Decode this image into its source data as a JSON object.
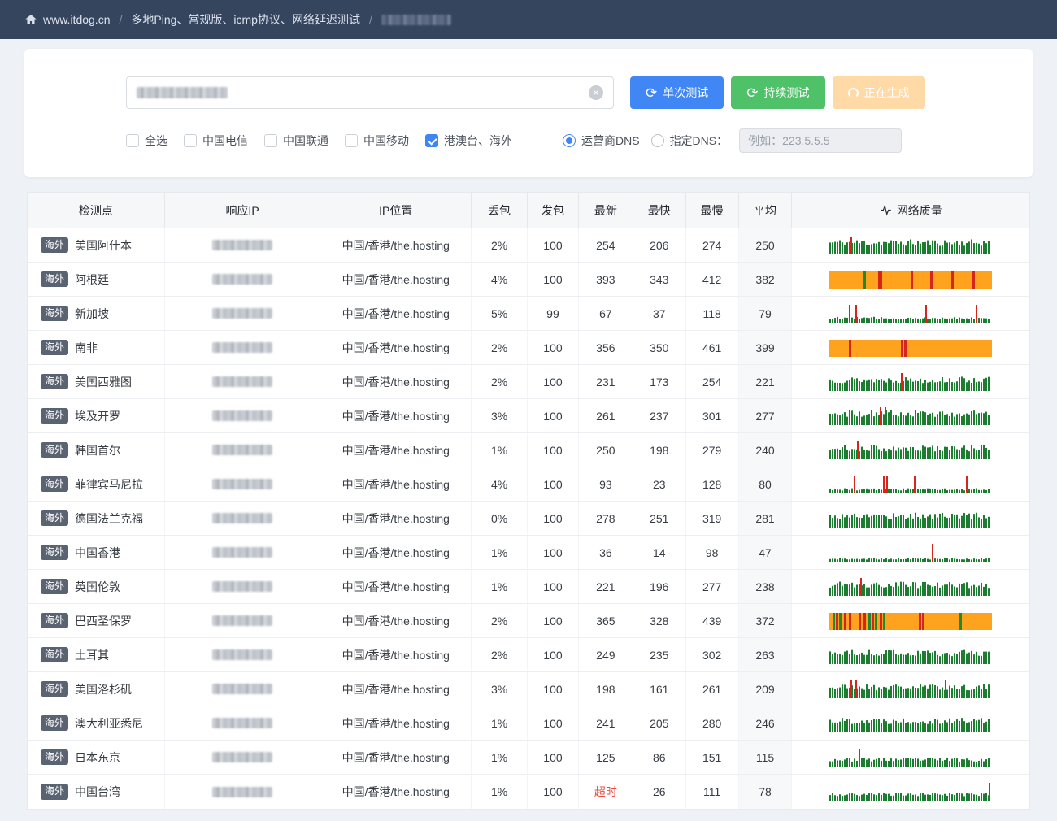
{
  "colors": {
    "topbar_bg": "#36455e",
    "primary_blue": "#4086f4",
    "success_green": "#4fc168",
    "generating_orange": "#ffd9a6",
    "badge_bg": "#5a6372",
    "timeout_red": "#e64c40",
    "chart_green": "#1c7d31",
    "chart_orange": "#ffa21d",
    "chart_red": "#d6261b",
    "chart_stripe_green": "#1d8a31"
  },
  "icons": {
    "clear": "✕",
    "refresh": "⟳"
  },
  "breadcrumb": {
    "site": "www.itdog.cn",
    "separator": "/",
    "items": [
      "多地Ping、常规版、icmp协议、网络延迟测试"
    ],
    "last_item_redacted": true
  },
  "controls": {
    "search_value_redacted": true,
    "buttons": [
      {
        "label": "单次测试",
        "style": "blue"
      },
      {
        "label": "持续测试",
        "style": "green"
      },
      {
        "label": "正在生成",
        "style": "orange"
      }
    ],
    "checkboxes": [
      {
        "label": "全选",
        "checked": false
      },
      {
        "label": "中国电信",
        "checked": false
      },
      {
        "label": "中国联通",
        "checked": false
      },
      {
        "label": "中国移动",
        "checked": false
      },
      {
        "label": "港澳台、海外",
        "checked": true
      }
    ],
    "radios": [
      {
        "label": "运营商DNS",
        "checked": true
      },
      {
        "label": "指定DNS：",
        "checked": false
      }
    ],
    "dns_input_placeholder": "例如：223.5.5.5"
  },
  "table": {
    "headers": [
      "检测点",
      "响应IP",
      "IP位置",
      "丢包",
      "发包",
      "最新",
      "最快",
      "最慢",
      "平均",
      "网络质量"
    ],
    "rows": [
      {
        "badge": "海外",
        "name": "美国阿什本",
        "ip_redacted": true,
        "ip_location": "中国/香港/the.hosting",
        "loss": "2%",
        "sent": "100",
        "latest": "254",
        "fastest": "206",
        "slowest": "274",
        "avg": "250",
        "chart": {
          "style": "green",
          "level": 0.85,
          "seed": 11,
          "spikes": [
            13
          ]
        }
      },
      {
        "badge": "海外",
        "name": "阿根廷",
        "ip_redacted": true,
        "ip_location": "中国/香港/the.hosting",
        "loss": "4%",
        "sent": "100",
        "latest": "393",
        "fastest": "343",
        "slowest": "412",
        "avg": "382",
        "chart": {
          "style": "orange",
          "red_stripes": [
            30,
            31,
            50,
            62,
            75,
            88
          ],
          "green_stripes": [
            21
          ]
        }
      },
      {
        "badge": "海外",
        "name": "新加坡",
        "ip_redacted": true,
        "ip_location": "中国/香港/the.hosting",
        "loss": "5%",
        "sent": "99",
        "latest": "67",
        "fastest": "37",
        "slowest": "118",
        "avg": "79",
        "chart": {
          "style": "green",
          "level": 0.33,
          "seed": 12,
          "spikes": [
            12,
            16,
            59,
            90
          ]
        }
      },
      {
        "badge": "海外",
        "name": "南非",
        "ip_redacted": true,
        "ip_location": "中国/香港/the.hosting",
        "loss": "2%",
        "sent": "100",
        "latest": "356",
        "fastest": "350",
        "slowest": "461",
        "avg": "399",
        "chart": {
          "style": "orange",
          "red_stripes": [
            12,
            44,
            46
          ],
          "green_stripes": []
        }
      },
      {
        "badge": "海外",
        "name": "美国西雅图",
        "ip_redacted": true,
        "ip_location": "中国/香港/the.hosting",
        "loss": "2%",
        "sent": "100",
        "latest": "231",
        "fastest": "173",
        "slowest": "254",
        "avg": "221",
        "chart": {
          "style": "green",
          "level": 0.8,
          "seed": 13,
          "spikes": [
            44
          ]
        }
      },
      {
        "badge": "海外",
        "name": "埃及开罗",
        "ip_redacted": true,
        "ip_location": "中国/香港/the.hosting",
        "loss": "3%",
        "sent": "100",
        "latest": "261",
        "fastest": "237",
        "slowest": "301",
        "avg": "277",
        "chart": {
          "style": "green",
          "level": 0.85,
          "seed": 14,
          "spikes": [
            31,
            34
          ]
        }
      },
      {
        "badge": "海外",
        "name": "韩国首尔",
        "ip_redacted": true,
        "ip_location": "中国/香港/the.hosting",
        "loss": "1%",
        "sent": "100",
        "latest": "250",
        "fastest": "198",
        "slowest": "279",
        "avg": "240",
        "chart": {
          "style": "green",
          "level": 0.8,
          "seed": 15,
          "spikes": [
            17
          ]
        }
      },
      {
        "badge": "海外",
        "name": "菲律宾马尼拉",
        "ip_redacted": true,
        "ip_location": "中国/香港/the.hosting",
        "loss": "4%",
        "sent": "100",
        "latest": "93",
        "fastest": "23",
        "slowest": "128",
        "avg": "80",
        "chart": {
          "style": "green",
          "level": 0.3,
          "seed": 16,
          "spikes": [
            15,
            33,
            35,
            52,
            84
          ]
        }
      },
      {
        "badge": "海外",
        "name": "德国法兰克福",
        "ip_redacted": true,
        "ip_location": "中国/香港/the.hosting",
        "loss": "0%",
        "sent": "100",
        "latest": "278",
        "fastest": "251",
        "slowest": "319",
        "avg": "281",
        "chart": {
          "style": "green",
          "level": 0.85,
          "seed": 17,
          "spikes": []
        }
      },
      {
        "badge": "海外",
        "name": "中国香港",
        "ip_redacted": true,
        "ip_location": "中国/香港/the.hosting",
        "loss": "1%",
        "sent": "100",
        "latest": "36",
        "fastest": "14",
        "slowest": "98",
        "avg": "47",
        "chart": {
          "style": "green",
          "level": 0.2,
          "seed": 18,
          "spikes": [
            63
          ]
        }
      },
      {
        "badge": "海外",
        "name": "英国伦敦",
        "ip_redacted": true,
        "ip_location": "中国/香港/the.hosting",
        "loss": "1%",
        "sent": "100",
        "latest": "221",
        "fastest": "196",
        "slowest": "277",
        "avg": "238",
        "chart": {
          "style": "green",
          "level": 0.8,
          "seed": 19,
          "spikes": [
            19
          ]
        }
      },
      {
        "badge": "海外",
        "name": "巴西圣保罗",
        "ip_redacted": true,
        "ip_location": "中国/香港/the.hosting",
        "loss": "2%",
        "sent": "100",
        "latest": "365",
        "fastest": "328",
        "slowest": "439",
        "avg": "372",
        "chart": {
          "style": "orange",
          "red_stripes": [
            4,
            9,
            12,
            18,
            21,
            26,
            31,
            55,
            57
          ],
          "green_stripes": [
            2,
            6,
            24,
            28,
            33,
            80
          ]
        }
      },
      {
        "badge": "海外",
        "name": "土耳其",
        "ip_redacted": true,
        "ip_location": "中国/香港/the.hosting",
        "loss": "2%",
        "sent": "100",
        "latest": "249",
        "fastest": "235",
        "slowest": "302",
        "avg": "263",
        "chart": {
          "style": "green",
          "level": 0.8,
          "seed": 20,
          "spikes": []
        }
      },
      {
        "badge": "海外",
        "name": "美国洛杉矶",
        "ip_redacted": true,
        "ip_location": "中国/香港/the.hosting",
        "loss": "3%",
        "sent": "100",
        "latest": "198",
        "fastest": "161",
        "slowest": "261",
        "avg": "209",
        "chart": {
          "style": "green",
          "level": 0.8,
          "seed": 21,
          "spikes": [
            13,
            16,
            71
          ]
        }
      },
      {
        "badge": "海外",
        "name": "澳大利亚悉尼",
        "ip_redacted": true,
        "ip_location": "中国/香港/the.hosting",
        "loss": "1%",
        "sent": "100",
        "latest": "241",
        "fastest": "205",
        "slowest": "280",
        "avg": "246",
        "chart": {
          "style": "green",
          "level": 0.85,
          "seed": 22,
          "spikes": []
        }
      },
      {
        "badge": "海外",
        "name": "日本东京",
        "ip_redacted": true,
        "ip_location": "中国/香港/the.hosting",
        "loss": "1%",
        "sent": "100",
        "latest": "125",
        "fastest": "86",
        "slowest": "151",
        "avg": "115",
        "chart": {
          "style": "green",
          "level": 0.5,
          "seed": 23,
          "spikes": [
            18
          ]
        }
      },
      {
        "badge": "海外",
        "name": "中国台湾",
        "ip_redacted": true,
        "ip_location": "中国/香港/the.hosting",
        "loss": "1%",
        "sent": "100",
        "latest": "超时",
        "fastest": "26",
        "slowest": "111",
        "avg": "78",
        "chart": {
          "style": "green",
          "level": 0.45,
          "seed": 24,
          "spikes": [
            98
          ]
        }
      }
    ]
  }
}
